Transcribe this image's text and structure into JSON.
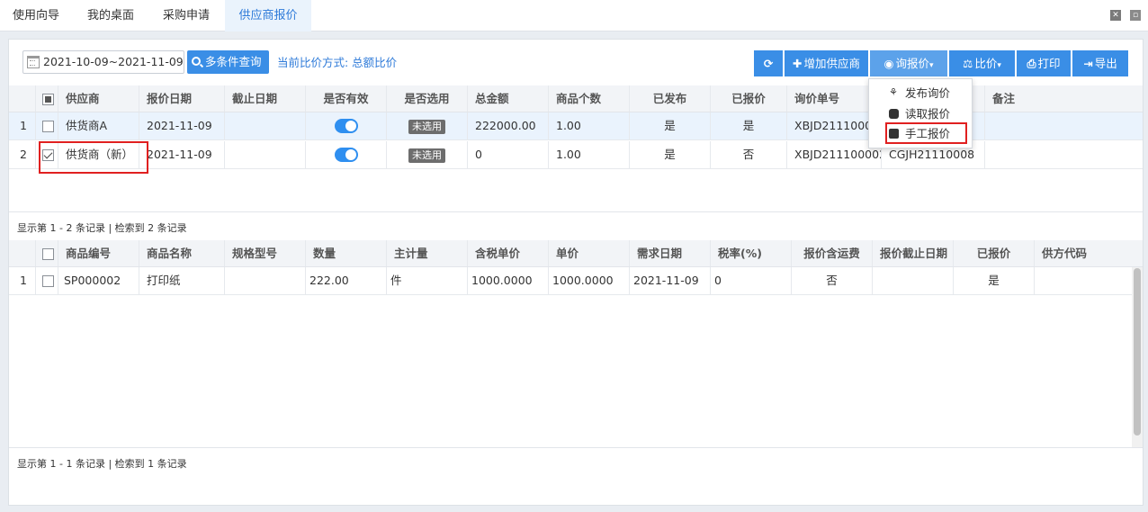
{
  "tabs": [
    {
      "label": "使用向导"
    },
    {
      "label": "我的桌面"
    },
    {
      "label": "采购申请"
    },
    {
      "label": "供应商报价",
      "active": true
    }
  ],
  "toolbar": {
    "date_range": "2021-10-09~2021-11-09",
    "query_label": "多条件查询",
    "compare_mode": "当前比价方式: 总额比价",
    "add_supplier": "增加供应商",
    "inquiry": "询报价",
    "compare": "比价",
    "print": "打印",
    "export": "导出"
  },
  "inquiry_menu": {
    "items": [
      "发布询价",
      "读取报价",
      "手工报价"
    ],
    "highlighted": "手工报价"
  },
  "supplier_grid": {
    "columns": [
      "供应商",
      "报价日期",
      "截止日期",
      "是否有效",
      "是否选用",
      "总金额",
      "商品个数",
      "已发布",
      "已报价",
      "询价单号",
      "",
      "备注"
    ],
    "rows": [
      {
        "idx": "1",
        "checked": false,
        "supplier": "供货商A",
        "quote_date": "2021-11-09",
        "deadline": "",
        "valid": true,
        "selected_tag": "未选用",
        "total": "222000.00",
        "count": "1.00",
        "published": "是",
        "quoted": "是",
        "inquiry_no": "XBJD21110000",
        "ref_no": "",
        "note": ""
      },
      {
        "idx": "2",
        "checked": true,
        "supplier": "供货商（新）",
        "quote_date": "2021-11-09",
        "deadline": "",
        "valid": true,
        "selected_tag": "未选用",
        "total": "0",
        "count": "1.00",
        "published": "是",
        "quoted": "否",
        "inquiry_no": "XBJD211100002",
        "ref_no": "CGJH21110008",
        "note": ""
      }
    ],
    "footer": "显示第 1 - 2 条记录 | 检索到 2 条记录"
  },
  "item_grid": {
    "columns": [
      "商品编号",
      "商品名称",
      "规格型号",
      "数量",
      "主计量",
      "含税单价",
      "单价",
      "需求日期",
      "税率(%)",
      "报价含运费",
      "报价截止日期",
      "已报价",
      "供方代码"
    ],
    "rows": [
      {
        "idx": "1",
        "checked": false,
        "code": "SP000002",
        "name": "打印纸",
        "spec": "",
        "qty": "222.00",
        "unit": "件",
        "tax_price": "1000.0000",
        "price": "1000.0000",
        "need_date": "2021-11-09",
        "tax_rate": "0",
        "freight": "否",
        "deadline": "",
        "quoted": "是",
        "vendor_code": ""
      }
    ],
    "footer": "显示第 1 - 1 条记录 | 检索到 1 条记录"
  },
  "colors": {
    "accent": "#3a8ee6",
    "tab_active_text": "#2f7bd9",
    "highlight_box": "#e02020",
    "tag_bg": "#6d6d6d"
  }
}
